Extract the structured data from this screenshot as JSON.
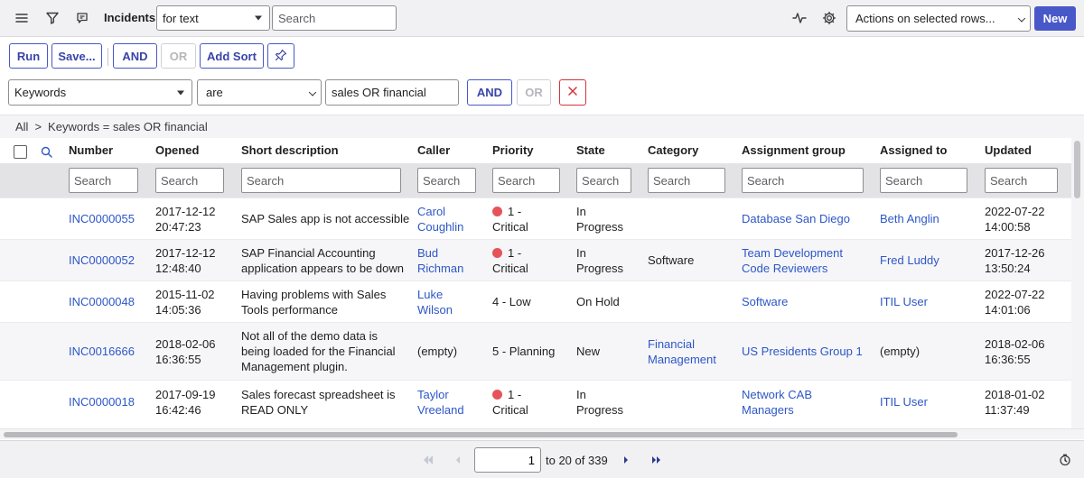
{
  "header": {
    "title": "Incidents",
    "search_field_select": "for text",
    "search_placeholder": "Search",
    "actions_select": "Actions on selected rows...",
    "new_label": "New",
    "icons": [
      "menu-icon",
      "filter-icon",
      "comment-icon",
      "activity-icon",
      "settings-icon"
    ]
  },
  "toolbar": {
    "run_label": "Run",
    "save_label": "Save...",
    "and_label": "AND",
    "or_label": "OR",
    "add_sort_label": "Add Sort"
  },
  "condition": {
    "field": "Keywords",
    "operator": "are",
    "value": "sales OR financial",
    "and_label": "AND",
    "or_label": "OR"
  },
  "breadcrumb": {
    "root": "All",
    "separator": ">",
    "current": "Keywords = sales OR financial"
  },
  "columns": [
    "Number",
    "Opened",
    "Short description",
    "Caller",
    "Priority",
    "State",
    "Category",
    "Assignment group",
    "Assigned to",
    "Updated"
  ],
  "column_search_placeholder": "Search",
  "rows": [
    {
      "number": "INC0000055",
      "opened": "2017-12-12\n20:47:23",
      "short_description": "SAP Sales app is not accessible",
      "caller": "Carol\nCoughlin",
      "priority": "1 -\nCritical",
      "critical": true,
      "state": "In\nProgress",
      "category": "",
      "assignment_group": "Database San Diego",
      "assigned_to": "Beth Anglin",
      "updated": "2022-07-22\n14:00:58"
    },
    {
      "number": "INC0000052",
      "opened": "2017-12-12\n12:48:40",
      "short_description": "SAP Financial Accounting\napplication appears to be down",
      "caller": "Bud\nRichman",
      "priority": "1 -\nCritical",
      "critical": true,
      "state": "In\nProgress",
      "category": "Software",
      "assignment_group": "Team Development\nCode Reviewers",
      "assigned_to": "Fred Luddy",
      "updated": "2017-12-26\n13:50:24"
    },
    {
      "number": "INC0000048",
      "opened": "2015-11-02\n14:05:36",
      "short_description": "Having problems with Sales\nTools performance",
      "caller": "Luke\nWilson",
      "priority": "4 - Low",
      "critical": false,
      "state": "On Hold",
      "category": "",
      "assignment_group": "Software",
      "assigned_to": "ITIL User",
      "updated": "2022-07-22\n14:01:06"
    },
    {
      "number": "INC0016666",
      "opened": "2018-02-06\n16:36:55",
      "short_description": "Not all of the demo data is\nbeing loaded for the Financial\nManagement plugin.",
      "caller": "(empty)",
      "priority": "5 - Planning",
      "critical": false,
      "state": "New",
      "category": "Financial\nManagement",
      "assignment_group": "US Presidents Group 1",
      "assigned_to": "(empty)",
      "updated": "2018-02-06\n16:36:55"
    },
    {
      "number": "INC0000018",
      "opened": "2017-09-19\n16:42:46",
      "short_description": "Sales forecast spreadsheet is\nREAD ONLY",
      "caller": "Taylor\nVreeland",
      "priority": "1 -\nCritical",
      "critical": true,
      "state": "In\nProgress",
      "category": "",
      "assignment_group": "Network CAB\nManagers",
      "assigned_to": "ITIL User",
      "updated": "2018-01-02\n11:37:49"
    }
  ],
  "pagination": {
    "current": "1",
    "range": "to 20 of 339"
  }
}
